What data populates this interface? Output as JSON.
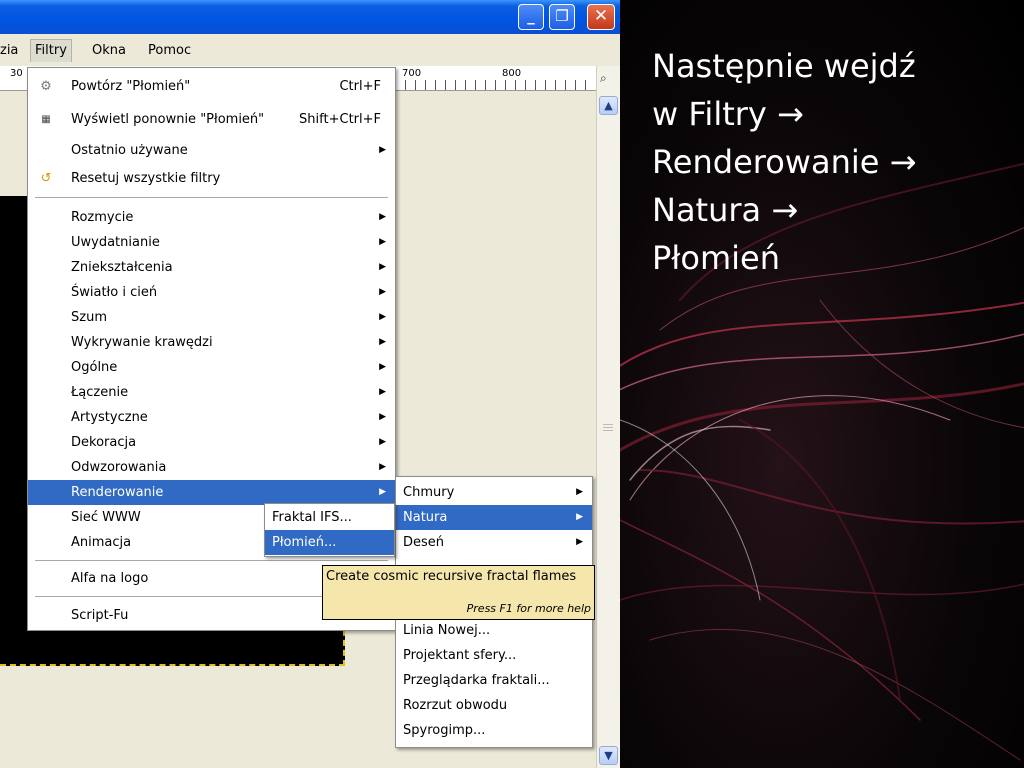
{
  "window": {
    "buttons": {
      "minimize": "_",
      "maximize": "❐",
      "close": "✕"
    }
  },
  "menubar": [
    "zia",
    "Filtry",
    "Okna",
    "Pomoc"
  ],
  "ruler": {
    "labels": [
      "30",
      "700",
      "800"
    ]
  },
  "filters_menu": {
    "repeat": {
      "label": "Powtórz \"Płomień\"",
      "shortcut": "Ctrl+F"
    },
    "reshow": {
      "label": "Wyświetl ponownie \"Płomień\"",
      "shortcut": "Shift+Ctrl+F"
    },
    "recent": "Ostatnio używane",
    "reset": "Resetuj wszystkie filtry",
    "items": [
      "Rozmycie",
      "Uwydatnianie",
      "Zniekształcenia",
      "Światło i cień",
      "Szum",
      "Wykrywanie krawędzi",
      "Ogólne",
      "Łączenie",
      "Artystyczne",
      "Dekoracja",
      "Odwzorowania",
      "Renderowanie",
      "Sieć WWW",
      "Animacja"
    ],
    "logo": "Alfa na logo",
    "scriptfu": "Script-Fu"
  },
  "render_menu": [
    "Chmury",
    "Natura",
    "Deseń",
    "Linia Nowej...",
    "Projektant sfery...",
    "Przeglądarka fraktali...",
    "Rozrzut obwodu",
    "Spyrogimp..."
  ],
  "natura_menu": [
    "Fraktal IFS...",
    "Płomień..."
  ],
  "tooltip": {
    "text": "Create cosmic recursive fractal flames",
    "help": "Press F1 for more help"
  },
  "slide": {
    "lines": [
      "Następnie wejdź",
      "w Filtry →",
      "Renderowanie →",
      "Natura →",
      "Płomień"
    ]
  },
  "colors": {
    "highlight": "#316ac5",
    "tooltip_bg": "#f5e7ac",
    "titlebar": "#0054e3"
  }
}
